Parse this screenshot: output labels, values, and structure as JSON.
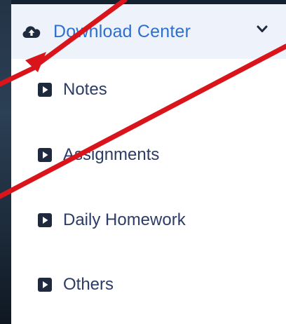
{
  "menu": {
    "header": {
      "title": "Download Center",
      "icon": "cloud-upload-icon",
      "expander_icon": "chevron-down-icon"
    },
    "items": [
      {
        "label": "Notes",
        "icon": "play-square-icon"
      },
      {
        "label": "Assignments",
        "icon": "play-square-icon"
      },
      {
        "label": "Daily Homework",
        "icon": "play-square-icon"
      },
      {
        "label": "Others",
        "icon": "play-square-icon"
      }
    ]
  },
  "colors": {
    "header_text": "#2e6fcf",
    "header_bg": "#eef3fb",
    "item_text": "#2d3c66",
    "icon_fill": "#202a3f",
    "annotation": "#d9141b"
  }
}
